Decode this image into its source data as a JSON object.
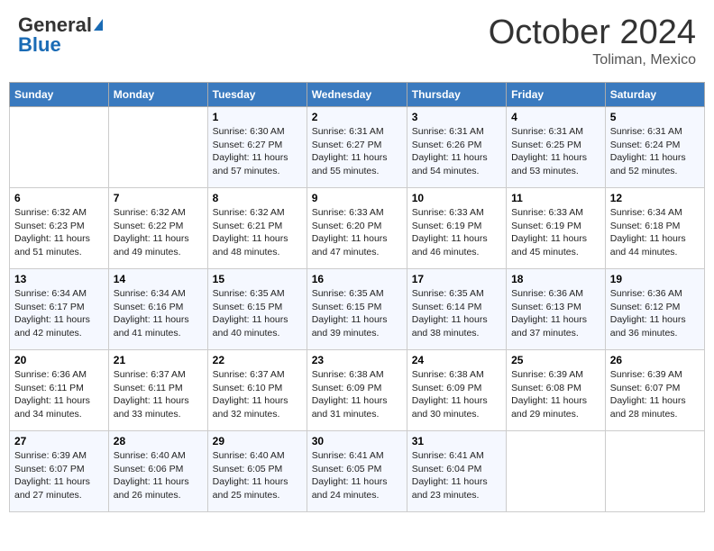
{
  "header": {
    "logo_general": "General",
    "logo_blue": "Blue",
    "month": "October 2024",
    "location": "Toliman, Mexico"
  },
  "weekdays": [
    "Sunday",
    "Monday",
    "Tuesday",
    "Wednesday",
    "Thursday",
    "Friday",
    "Saturday"
  ],
  "weeks": [
    [
      null,
      null,
      {
        "day": 1,
        "sunrise": "6:30 AM",
        "sunset": "6:27 PM",
        "daylight": "11 hours and 57 minutes."
      },
      {
        "day": 2,
        "sunrise": "6:31 AM",
        "sunset": "6:27 PM",
        "daylight": "11 hours and 55 minutes."
      },
      {
        "day": 3,
        "sunrise": "6:31 AM",
        "sunset": "6:26 PM",
        "daylight": "11 hours and 54 minutes."
      },
      {
        "day": 4,
        "sunrise": "6:31 AM",
        "sunset": "6:25 PM",
        "daylight": "11 hours and 53 minutes."
      },
      {
        "day": 5,
        "sunrise": "6:31 AM",
        "sunset": "6:24 PM",
        "daylight": "11 hours and 52 minutes."
      }
    ],
    [
      {
        "day": 6,
        "sunrise": "6:32 AM",
        "sunset": "6:23 PM",
        "daylight": "11 hours and 51 minutes."
      },
      {
        "day": 7,
        "sunrise": "6:32 AM",
        "sunset": "6:22 PM",
        "daylight": "11 hours and 49 minutes."
      },
      {
        "day": 8,
        "sunrise": "6:32 AM",
        "sunset": "6:21 PM",
        "daylight": "11 hours and 48 minutes."
      },
      {
        "day": 9,
        "sunrise": "6:33 AM",
        "sunset": "6:20 PM",
        "daylight": "11 hours and 47 minutes."
      },
      {
        "day": 10,
        "sunrise": "6:33 AM",
        "sunset": "6:19 PM",
        "daylight": "11 hours and 46 minutes."
      },
      {
        "day": 11,
        "sunrise": "6:33 AM",
        "sunset": "6:19 PM",
        "daylight": "11 hours and 45 minutes."
      },
      {
        "day": 12,
        "sunrise": "6:34 AM",
        "sunset": "6:18 PM",
        "daylight": "11 hours and 44 minutes."
      }
    ],
    [
      {
        "day": 13,
        "sunrise": "6:34 AM",
        "sunset": "6:17 PM",
        "daylight": "11 hours and 42 minutes."
      },
      {
        "day": 14,
        "sunrise": "6:34 AM",
        "sunset": "6:16 PM",
        "daylight": "11 hours and 41 minutes."
      },
      {
        "day": 15,
        "sunrise": "6:35 AM",
        "sunset": "6:15 PM",
        "daylight": "11 hours and 40 minutes."
      },
      {
        "day": 16,
        "sunrise": "6:35 AM",
        "sunset": "6:15 PM",
        "daylight": "11 hours and 39 minutes."
      },
      {
        "day": 17,
        "sunrise": "6:35 AM",
        "sunset": "6:14 PM",
        "daylight": "11 hours and 38 minutes."
      },
      {
        "day": 18,
        "sunrise": "6:36 AM",
        "sunset": "6:13 PM",
        "daylight": "11 hours and 37 minutes."
      },
      {
        "day": 19,
        "sunrise": "6:36 AM",
        "sunset": "6:12 PM",
        "daylight": "11 hours and 36 minutes."
      }
    ],
    [
      {
        "day": 20,
        "sunrise": "6:36 AM",
        "sunset": "6:11 PM",
        "daylight": "11 hours and 34 minutes."
      },
      {
        "day": 21,
        "sunrise": "6:37 AM",
        "sunset": "6:11 PM",
        "daylight": "11 hours and 33 minutes."
      },
      {
        "day": 22,
        "sunrise": "6:37 AM",
        "sunset": "6:10 PM",
        "daylight": "11 hours and 32 minutes."
      },
      {
        "day": 23,
        "sunrise": "6:38 AM",
        "sunset": "6:09 PM",
        "daylight": "11 hours and 31 minutes."
      },
      {
        "day": 24,
        "sunrise": "6:38 AM",
        "sunset": "6:09 PM",
        "daylight": "11 hours and 30 minutes."
      },
      {
        "day": 25,
        "sunrise": "6:39 AM",
        "sunset": "6:08 PM",
        "daylight": "11 hours and 29 minutes."
      },
      {
        "day": 26,
        "sunrise": "6:39 AM",
        "sunset": "6:07 PM",
        "daylight": "11 hours and 28 minutes."
      }
    ],
    [
      {
        "day": 27,
        "sunrise": "6:39 AM",
        "sunset": "6:07 PM",
        "daylight": "11 hours and 27 minutes."
      },
      {
        "day": 28,
        "sunrise": "6:40 AM",
        "sunset": "6:06 PM",
        "daylight": "11 hours and 26 minutes."
      },
      {
        "day": 29,
        "sunrise": "6:40 AM",
        "sunset": "6:05 PM",
        "daylight": "11 hours and 25 minutes."
      },
      {
        "day": 30,
        "sunrise": "6:41 AM",
        "sunset": "6:05 PM",
        "daylight": "11 hours and 24 minutes."
      },
      {
        "day": 31,
        "sunrise": "6:41 AM",
        "sunset": "6:04 PM",
        "daylight": "11 hours and 23 minutes."
      },
      null,
      null
    ]
  ]
}
